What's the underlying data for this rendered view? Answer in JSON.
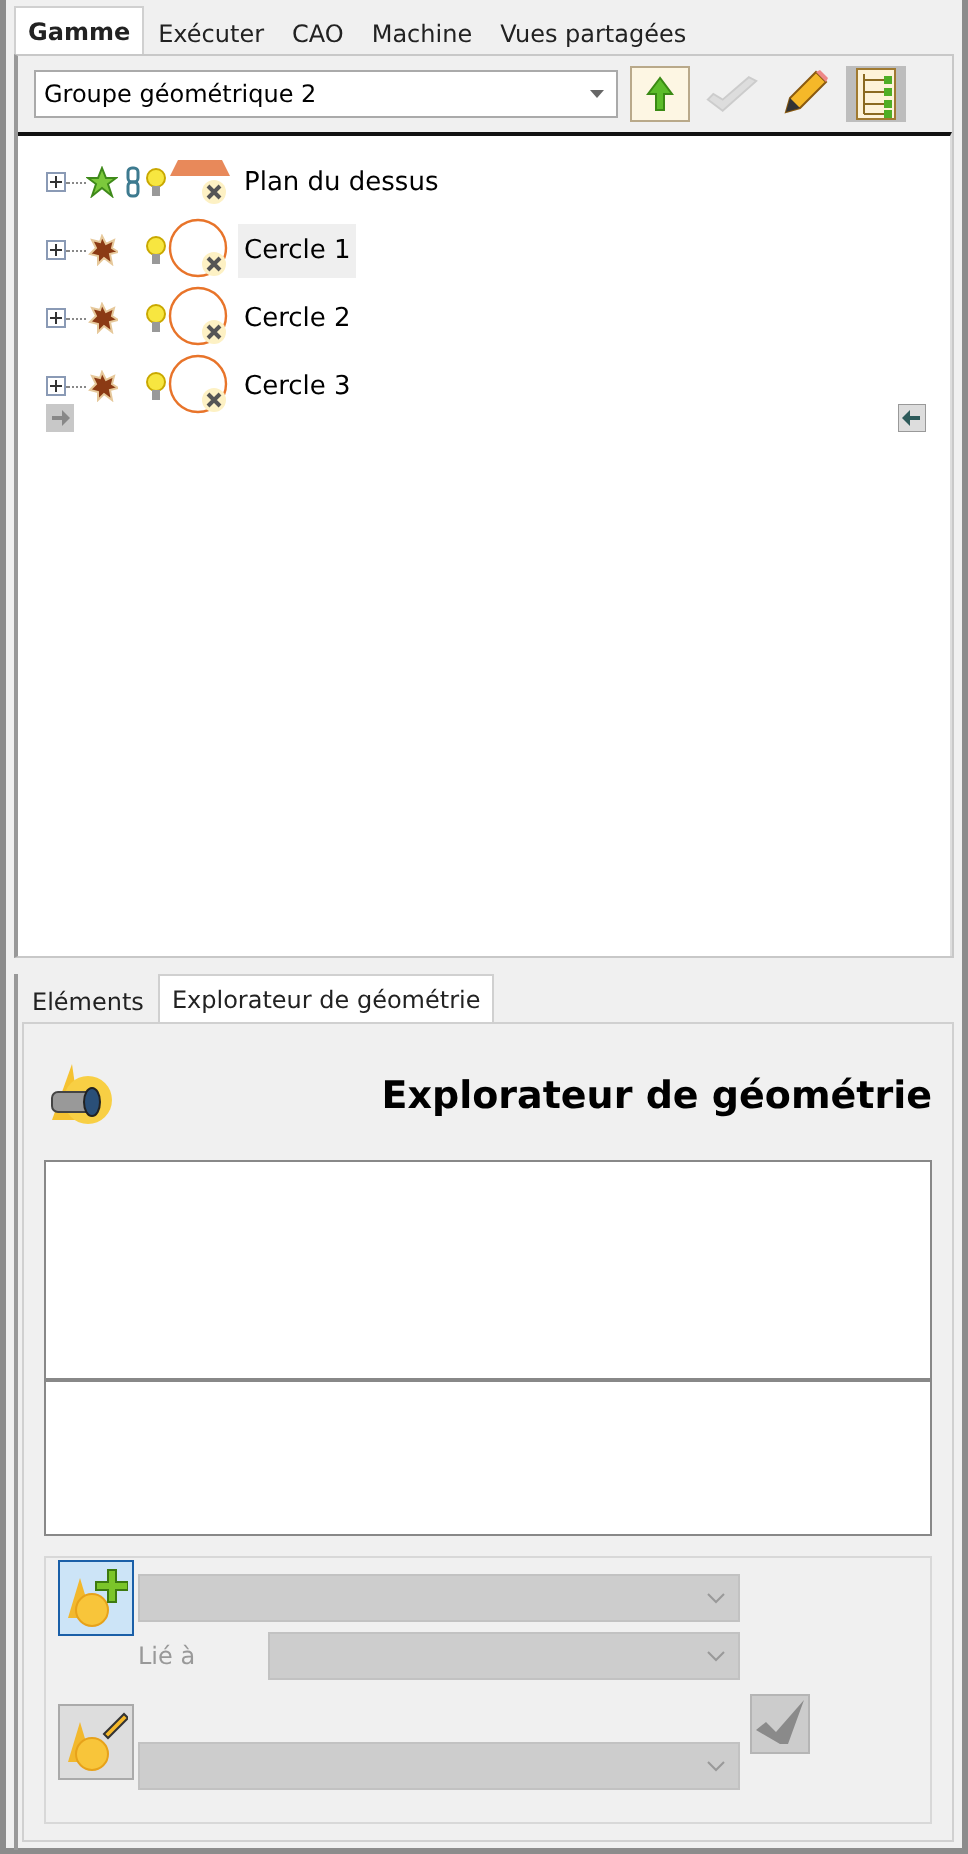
{
  "tabs": [
    {
      "label": "Gamme",
      "selected": true
    },
    {
      "label": "Exécuter",
      "selected": false
    },
    {
      "label": "CAO",
      "selected": false
    },
    {
      "label": "Machine",
      "selected": false
    },
    {
      "label": "Vues partagées",
      "selected": false
    }
  ],
  "toolbar": {
    "group_select": "Groupe géométrique 2",
    "tree_view_on": true
  },
  "tree": [
    {
      "label": "Plan du dessus",
      "kind": "plane",
      "active": true,
      "linked": true,
      "selected": false,
      "expanded": false
    },
    {
      "label": "Cercle 1",
      "kind": "circle",
      "active": false,
      "linked": false,
      "selected": true,
      "expanded": false
    },
    {
      "label": "Cercle 2",
      "kind": "circle",
      "active": false,
      "linked": false,
      "selected": false,
      "expanded": false
    },
    {
      "label": "Cercle 3",
      "kind": "circle",
      "active": false,
      "linked": false,
      "selected": false,
      "expanded": false
    }
  ],
  "bottom_tabs": [
    {
      "label": "Eléments",
      "selected": false
    },
    {
      "label": "Explorateur de géométrie",
      "selected": true
    }
  ],
  "explorer": {
    "title": "Explorateur de géométrie",
    "linked_label": "Lié à",
    "add_button_on": true
  }
}
